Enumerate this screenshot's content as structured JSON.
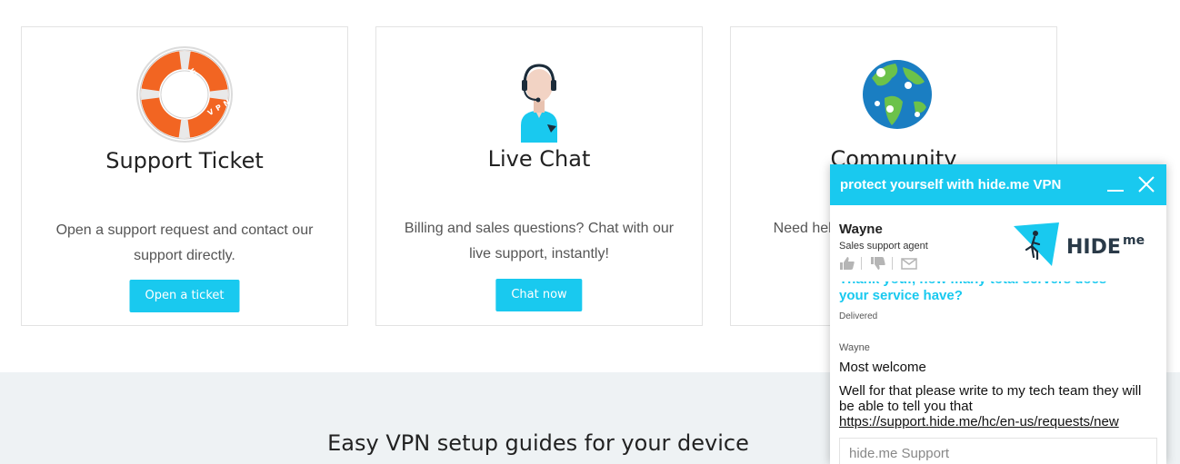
{
  "cards": [
    {
      "title": "Support Ticket",
      "description": "Open a support request and contact our support directly.",
      "button": "Open a ticket",
      "icon": "lifebuoy-icon",
      "icon_text_top": "HIDE.ME",
      "icon_text_bottom": "VPN"
    },
    {
      "title": "Live Chat",
      "description": "Billing and sales questions? Chat with our live support, instantly!",
      "button": "Chat now",
      "icon": "support-agent-icon"
    },
    {
      "title": "Community",
      "description": "Need help? Ask our community, our c",
      "button": "",
      "icon": "globe-icon"
    }
  ],
  "guides": {
    "title": "Easy VPN setup guides for your device"
  },
  "chat": {
    "header_title": "protect yourself with hide.me VPN",
    "agent_name": "Wayne",
    "agent_role": "Sales support agent",
    "logo_text": "HIDE",
    "logo_suffix": "me",
    "user_message": "Thank you!, how many total servers does your service have?",
    "status": "Delivered",
    "reply_author": "Wayne",
    "reply_1": "Most welcome",
    "reply_2": "Well for that please write to my tech team they will be able to tell you that",
    "reply_link": "https://support.hide.me/hc/en-us/requests/new",
    "input_placeholder": "hide.me Support"
  },
  "colors": {
    "accent": "#19c9ef",
    "section_bg": "#eef2f4",
    "lifebuoy": "#f26522",
    "globe_water": "#1a7ec2",
    "globe_land": "#6cc24a"
  }
}
